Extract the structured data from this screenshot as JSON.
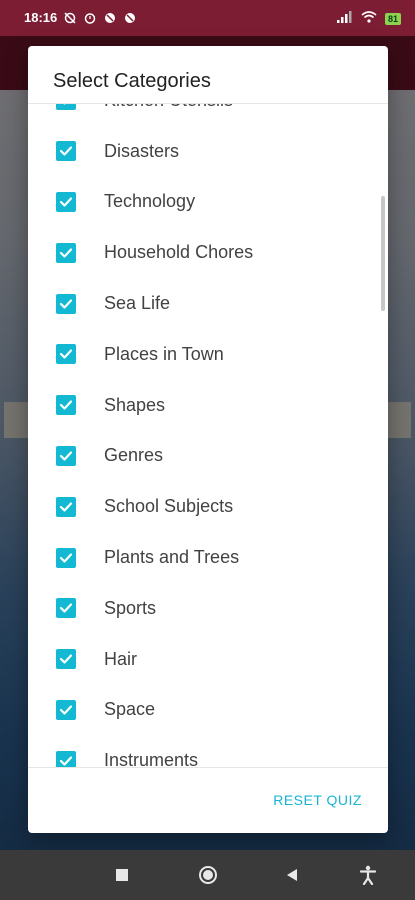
{
  "status_bar": {
    "time": "18:16",
    "battery": "81"
  },
  "dialog": {
    "title": "Select Categories",
    "items": [
      {
        "label": "Kitchen Utensils",
        "checked": true
      },
      {
        "label": "Disasters",
        "checked": true
      },
      {
        "label": "Technology",
        "checked": true
      },
      {
        "label": "Household Chores",
        "checked": true
      },
      {
        "label": "Sea Life",
        "checked": true
      },
      {
        "label": "Places in Town",
        "checked": true
      },
      {
        "label": "Shapes",
        "checked": true
      },
      {
        "label": "Genres",
        "checked": true
      },
      {
        "label": "School Subjects",
        "checked": true
      },
      {
        "label": "Plants and Trees",
        "checked": true
      },
      {
        "label": "Sports",
        "checked": true
      },
      {
        "label": "Hair",
        "checked": true
      },
      {
        "label": "Space",
        "checked": true
      },
      {
        "label": "Instruments",
        "checked": true
      }
    ],
    "reset_label": "RESET QUIZ"
  },
  "colors": {
    "accent": "#13b8d3",
    "status_bar": "#7d1d33",
    "nav_bar": "#3a3a3a"
  },
  "nav_bar": {
    "icons": [
      "recents-square-icon",
      "home-circle-icon",
      "back-triangle-icon",
      "accessibility-icon"
    ]
  }
}
